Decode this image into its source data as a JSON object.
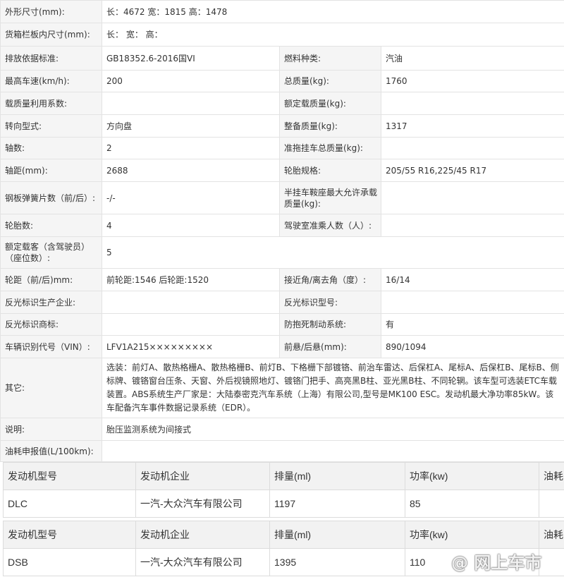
{
  "specs": [
    {
      "k1": "外形尺寸(mm):",
      "v1": "长：4672 宽：1815 高：1478"
    },
    {
      "k1": "货箱栏板内尺寸(mm):",
      "v1": "长： 宽： 高："
    },
    {
      "k1": "排放依据标准:",
      "v1": "GB18352.6-2016国VI",
      "k2": "燃料种类:",
      "v2": "汽油"
    },
    {
      "k1": "最高车速(km/h):",
      "v1": "200",
      "k2": "总质量(kg):",
      "v2": "1760"
    },
    {
      "k1": "载质量利用系数:",
      "v1": "",
      "k2": "额定载质量(kg):",
      "v2": ""
    },
    {
      "k1": "转向型式:",
      "v1": "方向盘",
      "k2": "整备质量(kg):",
      "v2": "1317"
    },
    {
      "k1": "轴数:",
      "v1": "2",
      "k2": "准拖挂车总质量(kg):",
      "v2": ""
    },
    {
      "k1": "轴距(mm):",
      "v1": "2688",
      "k2": "轮胎规格:",
      "v2": "205/55 R16,225/45 R17"
    },
    {
      "k1": "钢板弹簧片数（前/后）:",
      "v1": "-/-",
      "k2": "半挂车鞍座最大允许承载质量(kg):",
      "v2": ""
    },
    {
      "k1": "轮胎数:",
      "v1": "4",
      "k2": "驾驶室准乘人数（人）:",
      "v2": ""
    },
    {
      "k1": "额定载客（含驾驶员）（座位数）:",
      "v1": "5"
    },
    {
      "k1": "轮距（前/后)mm:",
      "v1": "前轮距:1546 后轮距:1520",
      "k2": "接近角/离去角（度）:",
      "v2": "16/14"
    },
    {
      "k1": "反光标识生产企业:",
      "v1": "",
      "k2": "反光标识型号:",
      "v2": ""
    },
    {
      "k1": "反光标识商标:",
      "v1": "",
      "k2": "防抱死制动系统:",
      "v2": "有"
    },
    {
      "k1": "车辆识别代号（VIN）:",
      "v1": "LFV1A215×××××××××",
      "k2": "前悬/后悬(mm):",
      "v2": "890/1094"
    },
    {
      "k1": "其它:",
      "v1": "选装：前灯A、散热格栅A、散热格栅B、前灯B、下格栅下部镀铬、前治车雷达、后保杠A、尾标A、后保杠B、尾标B、侧标牌、镀铬窗台压条、天窗、外后视镜照地灯、镀铬门把手、高亮黑B柱、亚光黑B柱、不同轮辋。该车型可选装ETC车载装置。ABS系统生产厂家是：大陆泰密克汽车系统（上海）有限公司,型号是MK100 ESC。发动机最大净功率85kW。该车配备汽车事件数据记录系统（EDR）。"
    },
    {
      "k1": "说明:",
      "v1": "胎压监测系统为间接式"
    },
    {
      "k1": "油耗申报值(L/100km):",
      "v1": ""
    }
  ],
  "engine_tables": [
    {
      "headers": [
        "发动机型号",
        "发动机企业",
        "排量(ml)",
        "功率(kw)",
        "油耗"
      ],
      "row": [
        "DLC",
        "一汽-大众汽车有限公司",
        "1197",
        "85",
        ""
      ]
    },
    {
      "headers": [
        "发动机型号",
        "发动机企业",
        "排量(ml)",
        "功率(kw)",
        "油耗"
      ],
      "row": [
        "DSB",
        "一汽-大众汽车有限公司",
        "1395",
        "110",
        ""
      ]
    }
  ],
  "watermark": "@ 网上车市"
}
